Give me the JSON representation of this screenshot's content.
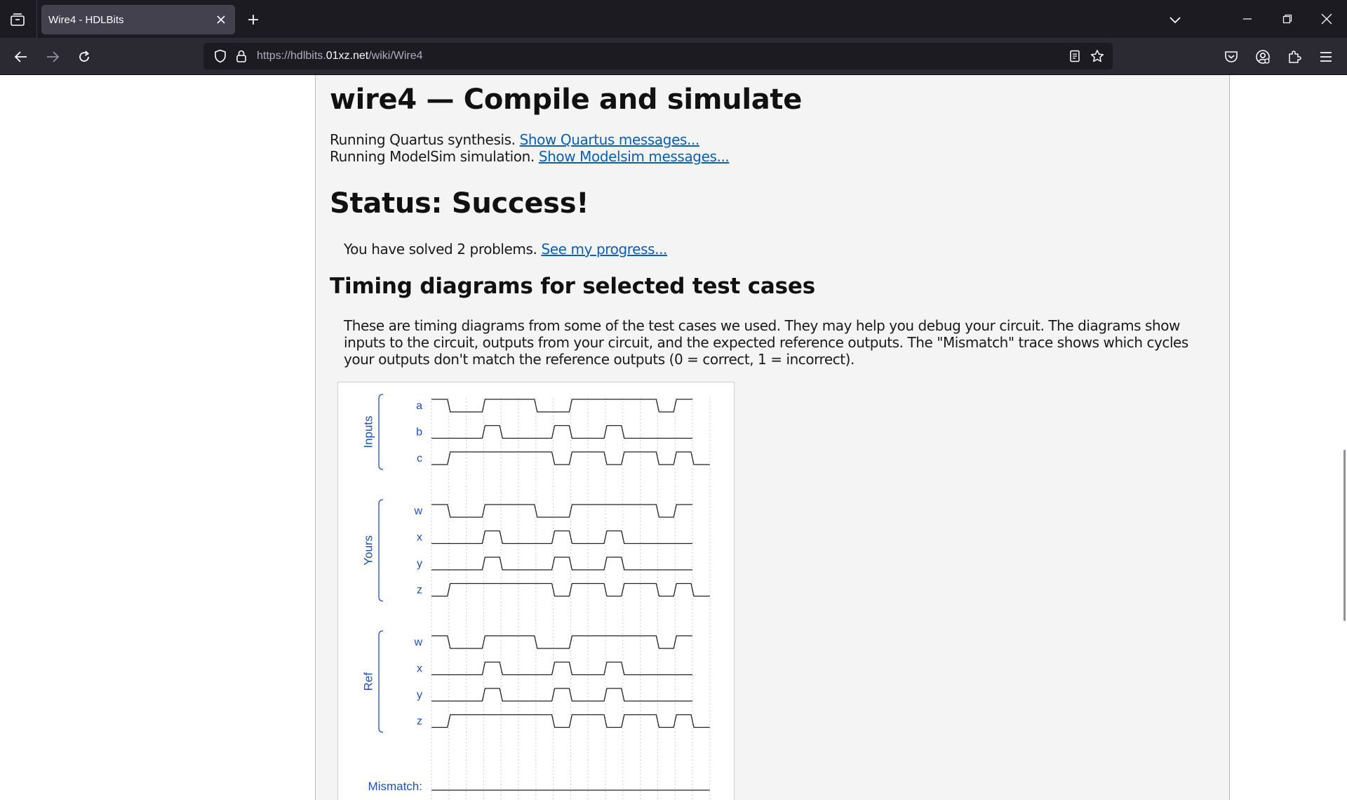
{
  "browser": {
    "tab": {
      "title": "Wire4 - HDLBits"
    },
    "url": {
      "prefix": "https://hdlbits.",
      "host": "01xz.net",
      "path": "/wiki/Wire4"
    }
  },
  "page": {
    "title": "wire4 — Compile and simulate",
    "synthesis": {
      "text": "Running Quartus synthesis. ",
      "link": "Show Quartus messages..."
    },
    "simulation": {
      "text": "Running ModelSim simulation. ",
      "link": "Show Modelsim messages..."
    },
    "status": "Status: Success!",
    "solved": {
      "text": "You have solved 2 problems. ",
      "link": "See my progress..."
    },
    "timing_heading": "Timing diagrams for selected test cases",
    "timing_description": "These are timing diagrams from some of the test cases we used. They may help you debug your circuit. The diagrams show inputs to the circuit, outputs from your circuit, and the expected reference outputs. The \"Mismatch\" trace shows which cycles your outputs don't match the reference outputs (0 = correct, 1 = incorrect)."
  },
  "chart_data": {
    "type": "timing",
    "x_ticks": [
      "5",
      "10",
      "15",
      "20",
      "25",
      "30",
      "35",
      "40",
      "45",
      "50",
      "55",
      "60",
      "65",
      "70",
      "75",
      "80"
    ],
    "groups": [
      {
        "label": "Inputs",
        "signals": [
          {
            "name": "a",
            "values": [
              1,
              0,
              0,
              1,
              1,
              1,
              0,
              0,
              1,
              1,
              1,
              1,
              1,
              0,
              1
            ]
          },
          {
            "name": "b",
            "values": [
              0,
              0,
              0,
              1,
              0,
              0,
              0,
              1,
              0,
              0,
              1,
              0,
              0,
              0,
              0
            ]
          },
          {
            "name": "c",
            "values": [
              0,
              1,
              1,
              1,
              1,
              1,
              1,
              0,
              1,
              1,
              0,
              1,
              1,
              0,
              1,
              0
            ]
          }
        ]
      },
      {
        "label": "Yours",
        "signals": [
          {
            "name": "w",
            "values": [
              1,
              0,
              0,
              1,
              1,
              1,
              0,
              0,
              1,
              1,
              1,
              1,
              1,
              0,
              1
            ]
          },
          {
            "name": "x",
            "values": [
              0,
              0,
              0,
              1,
              0,
              0,
              0,
              1,
              0,
              0,
              1,
              0,
              0,
              0,
              0
            ]
          },
          {
            "name": "y",
            "values": [
              0,
              0,
              0,
              1,
              0,
              0,
              0,
              1,
              0,
              0,
              1,
              0,
              0,
              0,
              0
            ]
          },
          {
            "name": "z",
            "values": [
              0,
              1,
              1,
              1,
              1,
              1,
              1,
              0,
              1,
              1,
              0,
              1,
              1,
              0,
              1,
              0
            ]
          }
        ]
      },
      {
        "label": "Ref",
        "signals": [
          {
            "name": "w",
            "values": [
              1,
              0,
              0,
              1,
              1,
              1,
              0,
              0,
              1,
              1,
              1,
              1,
              1,
              0,
              1
            ]
          },
          {
            "name": "x",
            "values": [
              0,
              0,
              0,
              1,
              0,
              0,
              0,
              1,
              0,
              0,
              1,
              0,
              0,
              0,
              0
            ]
          },
          {
            "name": "y",
            "values": [
              0,
              0,
              0,
              1,
              0,
              0,
              0,
              1,
              0,
              0,
              1,
              0,
              0,
              0,
              0
            ]
          },
          {
            "name": "z",
            "values": [
              0,
              1,
              1,
              1,
              1,
              1,
              1,
              0,
              1,
              1,
              0,
              1,
              1,
              0,
              1,
              0
            ]
          }
        ]
      }
    ],
    "mismatch": {
      "label": "Mismatch:",
      "values": [
        0,
        0,
        0,
        0,
        0,
        0,
        0,
        0,
        0,
        0,
        0,
        0,
        0,
        0,
        0,
        0
      ]
    },
    "grid": "dotted-vertical"
  },
  "colors": {
    "link": "#0b5fb5",
    "diagram_label": "#1f4fbf",
    "trace": "#222222"
  },
  "icons": [
    "tab-list-icon",
    "close-icon",
    "plus-icon",
    "chevron-down-icon",
    "minimize-icon",
    "restore-icon",
    "window-close-icon",
    "back-arrow-icon",
    "forward-arrow-icon",
    "reload-icon",
    "shield-icon",
    "lock-icon",
    "reader-view-icon",
    "star-icon",
    "pocket-icon",
    "account-icon",
    "extensions-icon",
    "menu-icon"
  ]
}
